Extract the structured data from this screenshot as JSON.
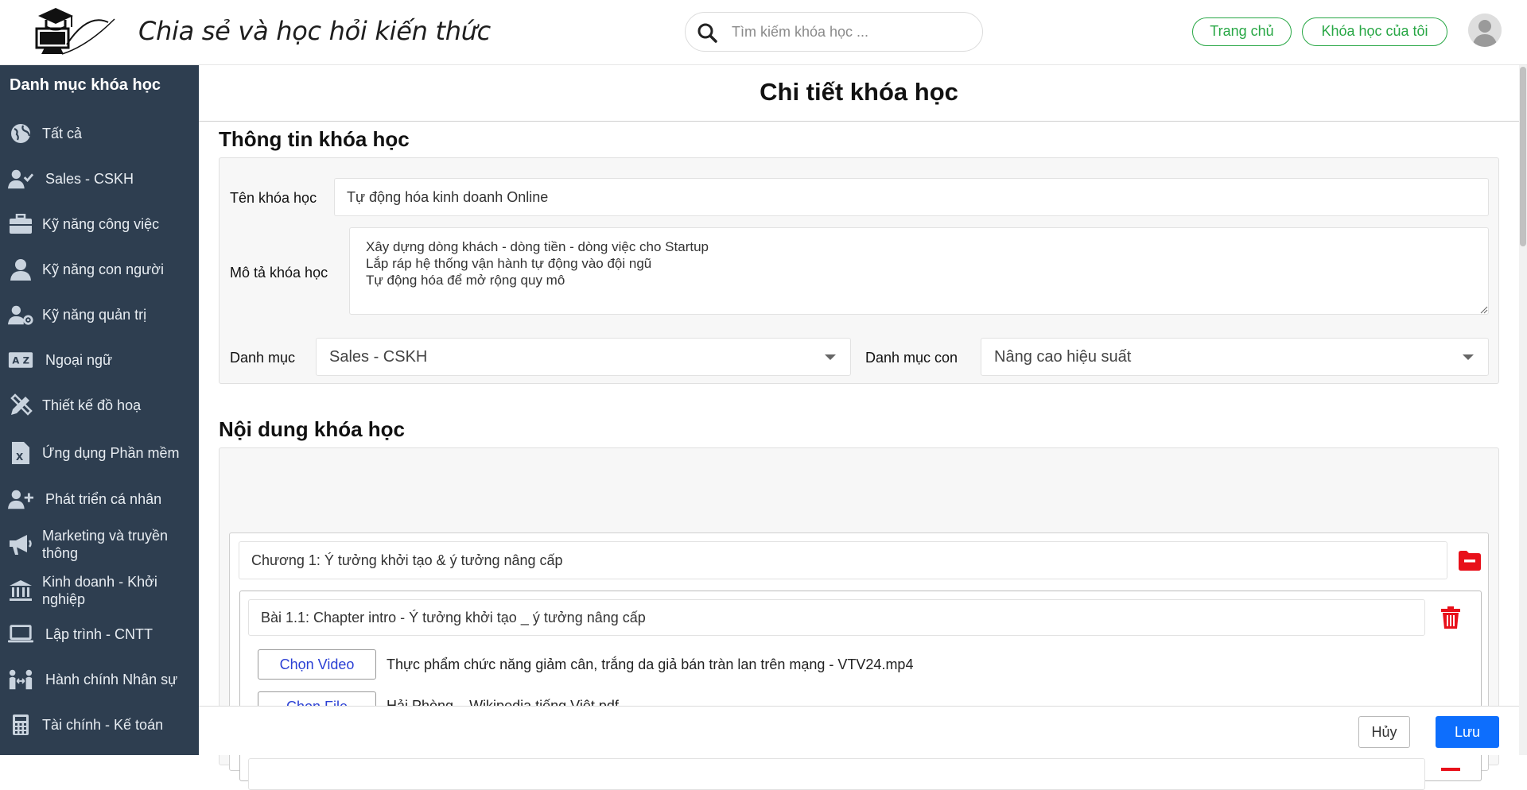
{
  "header": {
    "site_title": "Chia sẻ và học hỏi kiến thức",
    "search_placeholder": "Tìm kiếm khóa học ...",
    "home_label": "Trang chủ",
    "my_courses_label": "Khóa học của tôi"
  },
  "sidebar": {
    "title": "Danh mục khóa học",
    "items": [
      {
        "label": "Tất cả",
        "icon": "globe-icon"
      },
      {
        "label": "Sales - CSKH",
        "icon": "user-check-icon"
      },
      {
        "label": "Kỹ năng công việc",
        "icon": "briefcase-icon"
      },
      {
        "label": "Kỹ năng con người",
        "icon": "user-icon"
      },
      {
        "label": "Kỹ năng quản trị",
        "icon": "user-gear-icon"
      },
      {
        "label": "Ngoại ngữ",
        "icon": "language-icon"
      },
      {
        "label": "Thiết kế đồ hoạ",
        "icon": "pencil-ruler-icon"
      },
      {
        "label": "Ứng dụng Phần mềm",
        "icon": "excel-file-icon"
      },
      {
        "label": "Phát triển cá nhân",
        "icon": "user-plus-icon"
      },
      {
        "label": "Marketing và truyền thông",
        "icon": "megaphone-icon"
      },
      {
        "label": "Kinh doanh - Khởi nghiệp",
        "icon": "bank-icon"
      },
      {
        "label": "Lập trình - CNTT",
        "icon": "laptop-icon"
      },
      {
        "label": "Hành chính Nhân sự",
        "icon": "people-arrows-icon"
      },
      {
        "label": "Tài chính - Kế toán",
        "icon": "calculator-icon"
      }
    ]
  },
  "main": {
    "page_title": "Chi tiết khóa học",
    "info_section_title": "Thông tin khóa học",
    "name_label": "Tên khóa học",
    "name_value": "Tự động hóa kinh doanh Online",
    "desc_label": "Mô tả khóa học",
    "desc_value": "Xây dựng dòng khách - dòng tiền - dòng việc cho Startup\nLắp ráp hệ thống vận hành tự động vào đội ngũ\nTự động hóa để mở rộng quy mô",
    "category_label": "Danh mục",
    "category_value": "Sales - CSKH",
    "subcategory_label": "Danh mục con",
    "subcategory_value": "Nâng cao hiệu suất",
    "content_section_title": "Nội dung khóa học",
    "chapter_title": "Chương 1: Ý tưởng khởi tạo & ý tưởng nâng cấp",
    "lesson_title": "Bài 1.1: Chapter intro - Ý tưởng khởi tạo _ ý tưởng nâng cấp",
    "choose_video_label": "Chọn Video",
    "video_file": "Thực phẩm chức năng giảm cân, trắng da giả bán tràn lan trên mạng - VTV24.mp4",
    "choose_file_label": "Chọn File",
    "doc_file": "Hải Phòng – Wikipedia tiếng Việt.pdf"
  },
  "footer": {
    "cancel_label": "Hủy",
    "save_label": "Lưu"
  },
  "colors": {
    "sidebar_bg": "#2e3e50",
    "accent_green": "#28a745",
    "primary_blue": "#0d6efd",
    "danger_red": "#e8101a"
  }
}
